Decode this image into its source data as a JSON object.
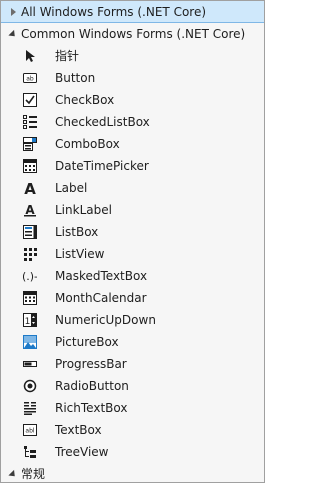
{
  "toolbox": {
    "groups": [
      {
        "label": "All Windows Forms (.NET Core)",
        "expanded": false
      },
      {
        "label": "Common Windows Forms (.NET Core)",
        "expanded": true
      },
      {
        "label": "常规",
        "expanded": true
      }
    ],
    "items": [
      {
        "label": "指针",
        "icon": "pointer-icon"
      },
      {
        "label": "Button",
        "icon": "button-icon"
      },
      {
        "label": "CheckBox",
        "icon": "checkbox-icon"
      },
      {
        "label": "CheckedListBox",
        "icon": "checkedlistbox-icon"
      },
      {
        "label": "ComboBox",
        "icon": "combobox-icon"
      },
      {
        "label": "DateTimePicker",
        "icon": "datetimepicker-icon"
      },
      {
        "label": "Label",
        "icon": "label-icon"
      },
      {
        "label": "LinkLabel",
        "icon": "linklabel-icon"
      },
      {
        "label": "ListBox",
        "icon": "listbox-icon"
      },
      {
        "label": "ListView",
        "icon": "listview-icon"
      },
      {
        "label": "MaskedTextBox",
        "icon": "maskedtextbox-icon"
      },
      {
        "label": "MonthCalendar",
        "icon": "monthcalendar-icon"
      },
      {
        "label": "NumericUpDown",
        "icon": "numericupdown-icon"
      },
      {
        "label": "PictureBox",
        "icon": "picturebox-icon"
      },
      {
        "label": "ProgressBar",
        "icon": "progressbar-icon"
      },
      {
        "label": "RadioButton",
        "icon": "radiobutton-icon"
      },
      {
        "label": "RichTextBox",
        "icon": "richtextbox-icon"
      },
      {
        "label": "TextBox",
        "icon": "textbox-icon"
      },
      {
        "label": "TreeView",
        "icon": "treeview-icon"
      }
    ]
  }
}
